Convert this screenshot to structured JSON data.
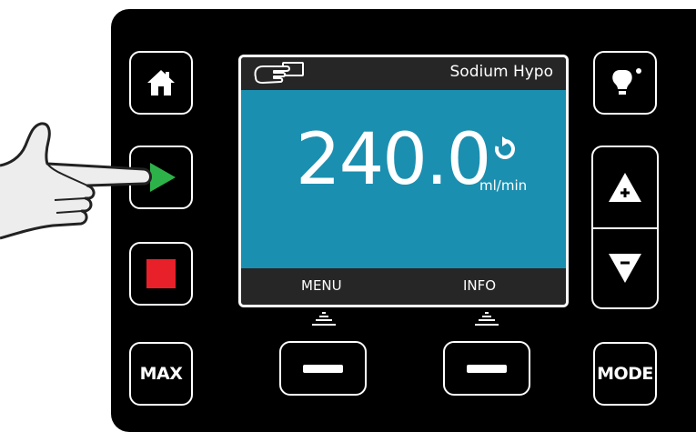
{
  "screen": {
    "product_name": "Sodium Hypo",
    "flow_value": "240.0",
    "flow_unit": "ml/min",
    "softkey_left_label": "MENU",
    "softkey_right_label": "INFO",
    "background_color": "#1b8fb0",
    "bar_color": "#262626"
  },
  "keys": {
    "max_label": "MAX",
    "mode_label": "MODE",
    "start_color": "#2db24a",
    "stop_color": "#e8202a"
  },
  "icons": {
    "home": "home-icon",
    "start": "play-icon",
    "stop": "stop-icon",
    "info": "lightbulb-icon",
    "up": "up-arrow-icon",
    "down": "down-arrow-icon",
    "hand_pointer": "hand-pointer-icon",
    "rotation": "clockwise-rotation-icon"
  }
}
